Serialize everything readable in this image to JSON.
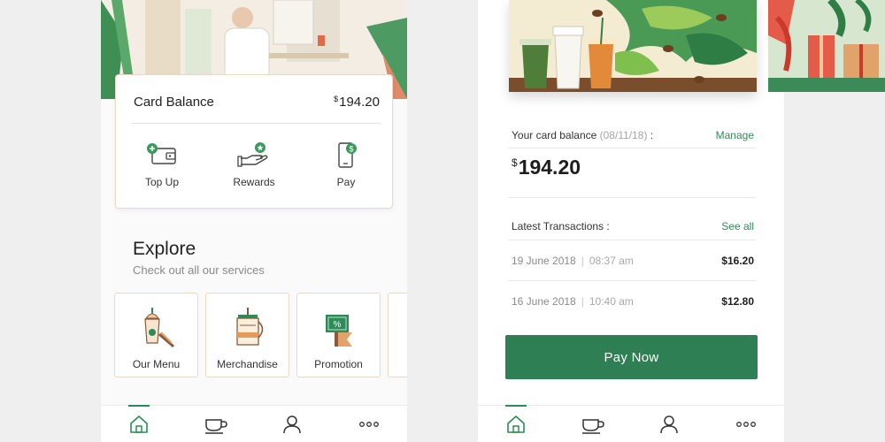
{
  "left_phone": {
    "balance_card": {
      "title": "Card Balance",
      "currency": "$",
      "amount": "194.20"
    },
    "quick_actions": [
      {
        "label": "Top Up",
        "icon": "wallet-plus-icon"
      },
      {
        "label": "Rewards",
        "icon": "hand-star-icon"
      },
      {
        "label": "Pay",
        "icon": "phone-dollar-icon"
      }
    ],
    "explore": {
      "title": "Explore",
      "subtitle": "Check out all our services"
    },
    "services": [
      {
        "label": "Our Menu",
        "icon": "menu-drink-icon"
      },
      {
        "label": "Merchandise",
        "icon": "french-press-icon"
      },
      {
        "label": "Promotion",
        "icon": "promotion-tag-icon"
      }
    ]
  },
  "right_phone": {
    "card_balance_label": "Your card balance",
    "card_balance_date": "(08/11/18)",
    "manage_label": "Manage",
    "currency": "$",
    "amount": "194.20",
    "transactions_label": "Latest Transactions",
    "see_all_label": "See all",
    "transactions": [
      {
        "date": "19 June 2018",
        "time": "08:37 am",
        "amount": "$16.20"
      },
      {
        "date": "16 June 2018",
        "time": "10:40 am",
        "amount": "$12.80"
      }
    ],
    "pay_now_label": "Pay Now"
  },
  "bottom_nav": [
    {
      "icon": "home-icon",
      "active": true
    },
    {
      "icon": "coffee-cup-icon",
      "active": false
    },
    {
      "icon": "profile-icon",
      "active": false
    },
    {
      "icon": "more-icon",
      "active": false
    }
  ],
  "colors": {
    "accent": "#2e8b57",
    "button": "#2e7f53",
    "tile_border": "#ead9c4",
    "background": "#efefef"
  }
}
